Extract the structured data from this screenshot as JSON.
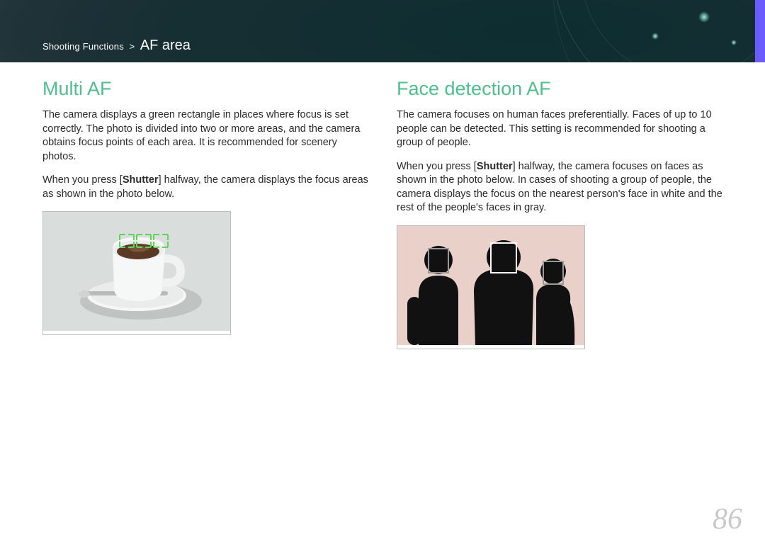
{
  "breadcrumb": {
    "section": "Shooting Functions",
    "chev": ">",
    "title": "AF area"
  },
  "left": {
    "heading": "Multi AF",
    "p1": "The camera displays a green rectangle in places where focus is set correctly. The photo is divided into two or more areas, and the camera obtains focus points of each area. It is recommended for scenery photos.",
    "p2a": "When you press [",
    "p2b": "Shutter",
    "p2c": "] halfway, the camera displays the focus areas as shown in the photo below.",
    "figure_alt": "Coffee cup photo with green multi-AF focus brackets"
  },
  "right": {
    "heading": "Face detection AF",
    "p1": "The camera focuses on human faces preferentially. Faces of up to 10 people can be detected. This setting is recommended for shooting a group of people.",
    "p2a": "When you press [",
    "p2b": "Shutter",
    "p2c": "] halfway, the camera focuses on faces as shown in the photo below. In cases of shooting a group of people, the camera displays the focus on the nearest person's face in white and the rest of the people's faces in gray.",
    "figure_alt": "Three silhouetted people with face-detection focus boxes"
  },
  "page_number": "86",
  "colors": {
    "accent": "#4fbf8e",
    "tab": "#6a5cff",
    "af_green": "#5fd35a"
  }
}
